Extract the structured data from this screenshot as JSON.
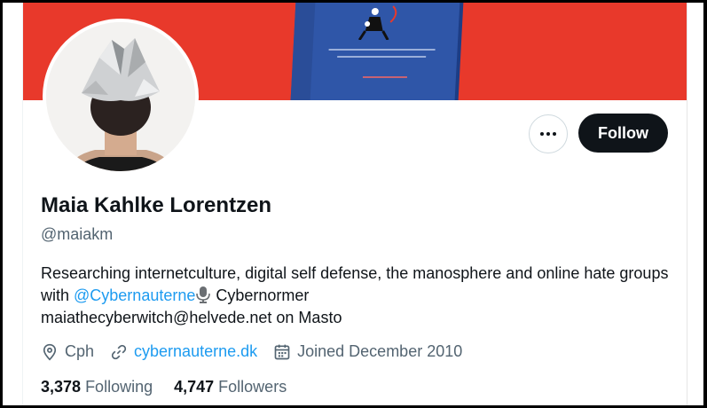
{
  "profile": {
    "name": "Maia Kahlke Lorentzen",
    "handle": "@maiakm",
    "bio": {
      "part1": "Researching internetculture, digital self defense, the manosphere and online hate groups with ",
      "mention": "@Cybernauterne",
      "part2": " Cybernormer",
      "line3": "maiathecyberwitch@helvede.net on Masto"
    },
    "location": "Cph",
    "website": "cybernauterne.dk",
    "joined": "Joined December 2010",
    "following_count": "3,378",
    "following_label": "Following",
    "followers_count": "4,747",
    "followers_label": "Followers"
  },
  "actions": {
    "follow_label": "Follow"
  },
  "colors": {
    "banner": "#e8392b",
    "accent": "#1d9bf0",
    "follow_bg": "#0f1419"
  },
  "icons": [
    "more-icon",
    "location-icon",
    "link-icon",
    "calendar-icon",
    "microphone-icon"
  ]
}
